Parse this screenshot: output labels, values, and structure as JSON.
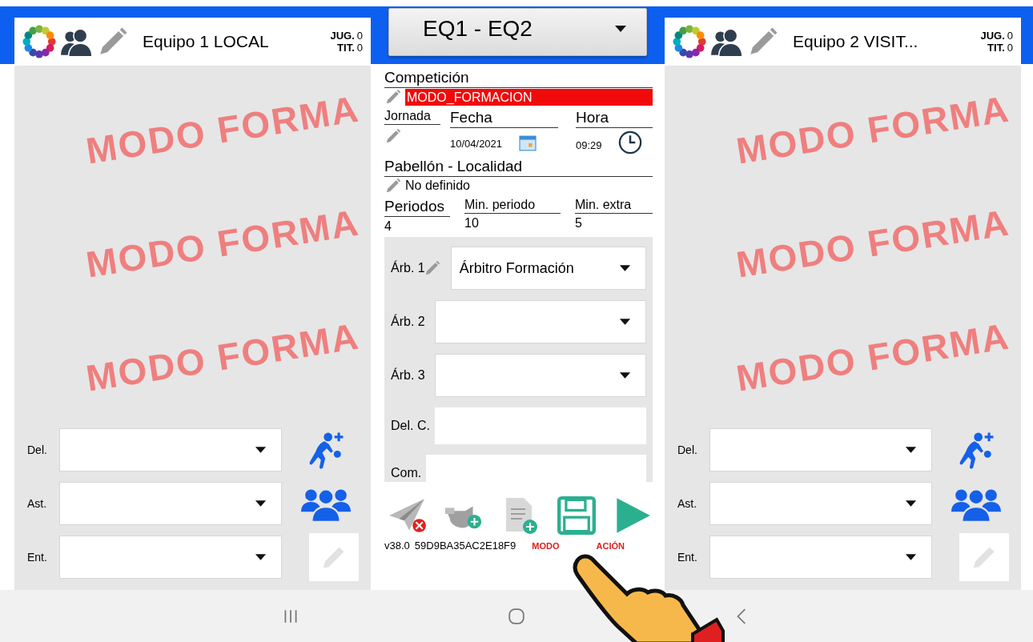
{
  "match_selector": {
    "value": "EQ1 - EQ2"
  },
  "teams": [
    {
      "name": "Equipo 1 LOCAL",
      "jug_label": "JUG.",
      "jug": "0",
      "tit_label": "TIT.",
      "tit": "0",
      "watermarks": [
        "MODO FORMA",
        "MODO FORMA",
        "MODO FORMA"
      ],
      "staff": [
        {
          "label": "Del.",
          "kind": "player"
        },
        {
          "label": "Ast.",
          "kind": "group"
        },
        {
          "label": "Ent.",
          "kind": "edit"
        }
      ]
    },
    {
      "name": "Equipo 2 VISIT...",
      "jug_label": "JUG.",
      "jug": "0",
      "tit_label": "TIT.",
      "tit": "0",
      "watermarks": [
        "MODO FORMA",
        "MODO FORMA",
        "MODO FORMA"
      ],
      "staff": [
        {
          "label": "Del.",
          "kind": "player"
        },
        {
          "label": "Ast.",
          "kind": "group"
        },
        {
          "label": "Ent.",
          "kind": "edit"
        }
      ]
    }
  ],
  "competition": {
    "label": "Competición",
    "value": "MODO_FORMACION"
  },
  "jornada": {
    "label": "Jornada"
  },
  "fecha": {
    "label": "Fecha",
    "value": "10/04/2021"
  },
  "hora": {
    "label": "Hora",
    "value": "09:29"
  },
  "venue": {
    "label": "Pabellón - Localidad",
    "value": "No definido"
  },
  "periods": [
    {
      "label": "Periodos",
      "value": "4"
    },
    {
      "label": "Min. periodo",
      "value": "10"
    },
    {
      "label": "Min. extra",
      "value": "5"
    }
  ],
  "officials": [
    {
      "label": "Árb. 1",
      "kind": "select",
      "editable": true,
      "value": "Árbitro Formación"
    },
    {
      "label": "Árb. 2",
      "kind": "select",
      "editable": false
    },
    {
      "label": "Árb. 3",
      "kind": "select",
      "editable": false
    },
    {
      "label": "Del. C.",
      "kind": "text",
      "editable": false
    },
    {
      "label": "Com.",
      "kind": "text",
      "editable": false
    }
  ],
  "footer": {
    "version": "v38.0",
    "device_id": "59D9BA35AC2E18F9",
    "mode_label_parts": [
      "MODO",
      "ACIÓN"
    ]
  }
}
